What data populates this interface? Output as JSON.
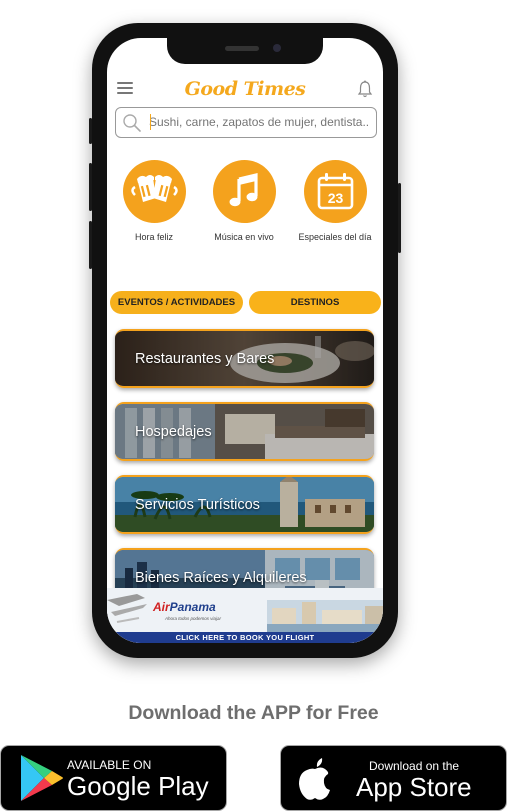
{
  "app": {
    "logo_text": "Good Times",
    "search": {
      "placeholder": "Sushi, carne, zapatos de mujer, dentista..."
    }
  },
  "categories": [
    {
      "label": "Hora feliz",
      "icon": "beer-mugs-icon"
    },
    {
      "label": "Música en vivo",
      "icon": "music-note-icon"
    },
    {
      "label": "Especiales del día",
      "icon": "calendar-icon",
      "icon_text": "23"
    }
  ],
  "tabs": [
    {
      "label": "EVENTOS / ACTIVIDADES"
    },
    {
      "label": "DESTINOS"
    }
  ],
  "cards": [
    {
      "title": "Restaurantes y Bares"
    },
    {
      "title": "Hospedajes"
    },
    {
      "title": "Servicios Turísticos"
    },
    {
      "title": "Bienes Raíces y Alquileres"
    }
  ],
  "banner": {
    "brand_part1": "Air",
    "brand_part2": "Panama",
    "slogan": "Ahora todos podemos viajar",
    "cta": "CLICK HERE TO BOOK YOU FLIGHT"
  },
  "download": {
    "title": "Download the APP for Free",
    "google": {
      "small": "AVAILABLE ON",
      "big": "Google Play"
    },
    "apple": {
      "small": "Download on the",
      "big": "App Store"
    }
  },
  "colors": {
    "accent": "#f4a21d",
    "banner_blue": "#1f3c8f"
  }
}
